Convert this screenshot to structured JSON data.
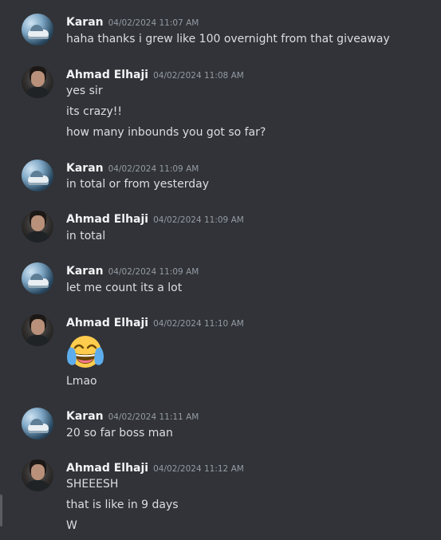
{
  "messages": [
    {
      "author": "Karan",
      "timestamp": "04/02/2024 11:07 AM",
      "lines": [
        "haha thanks i grew like 100 overnight from that giveaway"
      ]
    },
    {
      "author": "Ahmad Elhaji",
      "timestamp": "04/02/2024 11:08 AM",
      "lines": [
        "yes sir",
        "its crazy!!",
        "how many inbounds you got so far?"
      ]
    },
    {
      "author": "Karan",
      "timestamp": "04/02/2024 11:09 AM",
      "lines": [
        "in total or from yesterday"
      ]
    },
    {
      "author": "Ahmad Elhaji",
      "timestamp": "04/02/2024 11:09 AM",
      "lines": [
        "in total"
      ]
    },
    {
      "author": "Karan",
      "timestamp": "04/02/2024 11:09 AM",
      "lines": [
        "let me count its a lot"
      ]
    },
    {
      "author": "Ahmad Elhaji",
      "timestamp": "04/02/2024 11:10 AM",
      "emoji": "face-with-tears-of-joy",
      "lines": [
        "Lmao"
      ]
    },
    {
      "author": "Karan",
      "timestamp": "04/02/2024 11:11 AM",
      "lines": [
        "20 so far boss man"
      ]
    },
    {
      "author": "Ahmad Elhaji",
      "timestamp": "04/02/2024 11:12 AM",
      "lines": [
        "SHEEESH",
        "that is like in 9 days",
        "W"
      ]
    }
  ]
}
